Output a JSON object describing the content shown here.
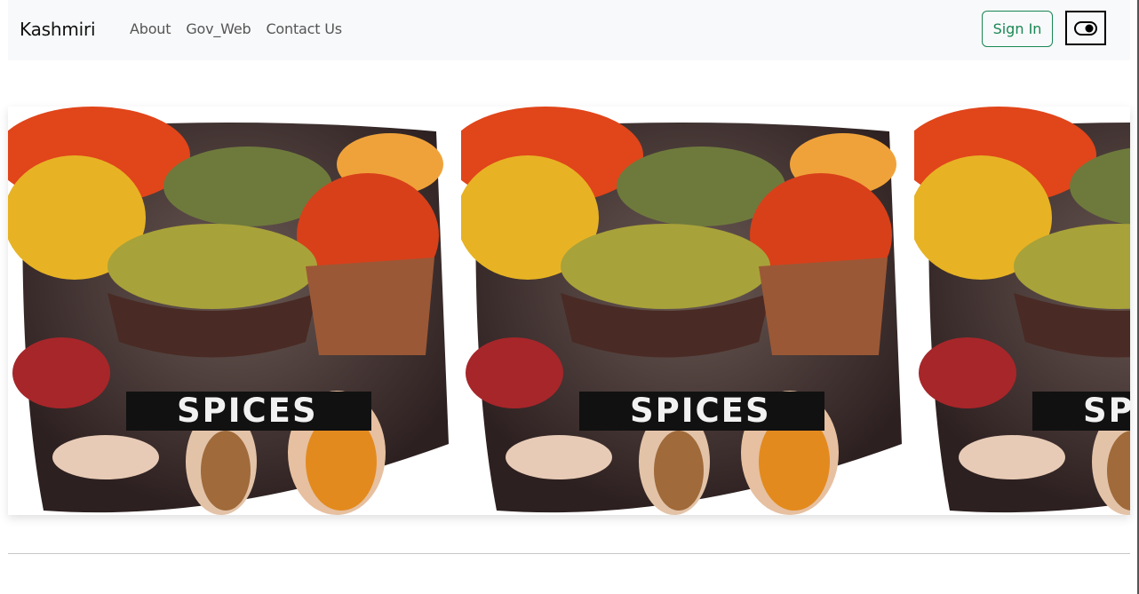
{
  "navbar": {
    "brand": "Kashmiri",
    "links": [
      {
        "label": "About"
      },
      {
        "label": "Gov_Web"
      },
      {
        "label": "Contact Us"
      }
    ],
    "signin_label": "Sign In",
    "toggle_icon": "toggle-switch-icon"
  },
  "carousel": {
    "slides": [
      {
        "label": "SPICES"
      },
      {
        "label": "SPICES"
      },
      {
        "label": "SPICES"
      }
    ]
  },
  "colors": {
    "navbar_bg": "#f8f9fa",
    "signin_accent": "#198754",
    "turmeric": "#e5b526",
    "chili": "#d9441a",
    "herb": "#9a9a30"
  }
}
